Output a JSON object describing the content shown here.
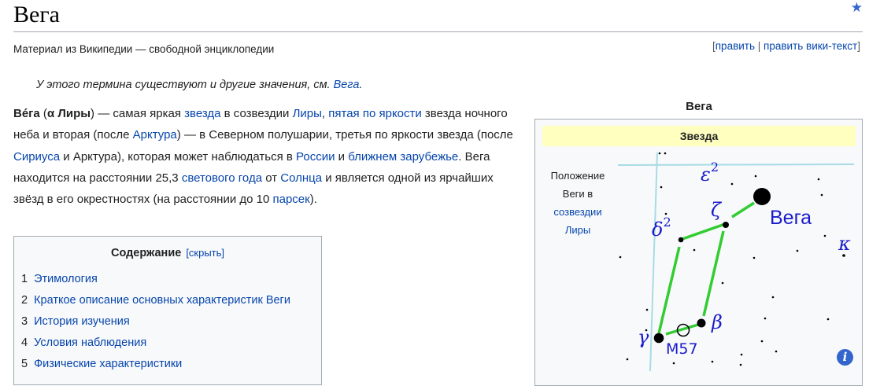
{
  "page": {
    "title": "Вега",
    "tagline": "Материал из Википедии — свободной энциклопедии",
    "star_icon": "star-icon"
  },
  "edit": {
    "bracket_open": "[",
    "edit_label": "править",
    "separator": " | ",
    "edit_source_label": "править вики-текст",
    "bracket_close": "]"
  },
  "hatnote": {
    "text": "У этого термина существуют и другие значения, см. ",
    "link": "Вега",
    "end": "."
  },
  "lead": {
    "t01": "Вéга",
    "t02": " (",
    "t03": "α Лиры",
    "t04": ") — самая яркая ",
    "l01": "звезда",
    "t05": " в созвездии ",
    "l02": "Лиры",
    "t06": ", ",
    "l03": "пятая по яркости",
    "t07": " звезда ночного неба и вторая (после ",
    "l04": "Арктура",
    "t08": ") — в Северном полушарии, третья по яркости звезда (после ",
    "l05": "Сириуса",
    "t09": " и Арктура), которая может наблюдаться в ",
    "l06": "России",
    "t10": " и ",
    "l07": "ближнем зарубежье",
    "t11": ". Вега находится на расстоянии 25,3 ",
    "l08": "светового года",
    "t12": " от ",
    "l09": "Солнца",
    "t13": " и является одной из ярчайших звёзд в его окрестностях (на расстоянии до 10 ",
    "l10": "парсек",
    "t14": ")."
  },
  "toc": {
    "title": "Содержание",
    "toggle": "[скрыть]",
    "items": [
      {
        "num": "1",
        "label": "Этимология"
      },
      {
        "num": "2",
        "label": "Краткое описание основных характеристик Веги"
      },
      {
        "num": "3",
        "label": "История изучения"
      },
      {
        "num": "4",
        "label": "Условия наблюдения"
      },
      {
        "num": "5",
        "label": "Физические характеристики"
      }
    ]
  },
  "infobox": {
    "caption": "Вега",
    "header": "Звезда",
    "map_label_line1": "Положение",
    "map_label_line2": "Веги в",
    "map_label_link1": "созвездии",
    "map_label_link2": "Лиры",
    "info_icon": "i"
  },
  "starmap": {
    "vega": "Вега",
    "epsilon": "ε",
    "epsilon_sup": "2",
    "zeta": "ζ",
    "delta": "δ",
    "delta_sup": "2",
    "kappa": "κ",
    "gamma": "γ",
    "beta": "β",
    "m57": "M57",
    "line_color": "#33cc33",
    "label_color": "#1a1acc",
    "grid_color": "#a8dbe6"
  }
}
